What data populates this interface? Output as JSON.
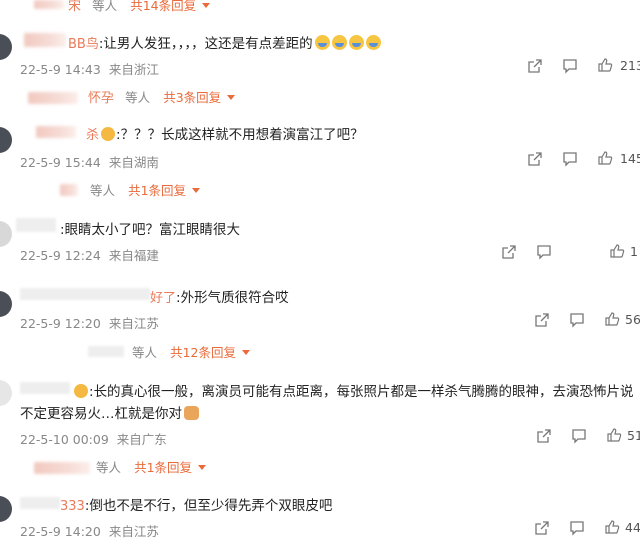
{
  "comments": [
    {
      "reply_thread": {
        "user": "宋",
        "dengren": "等人",
        "count_label": "共14条回复"
      },
      "user": "BB鸟",
      "text": "让男人发狂，，，，这还是有点差距的",
      "emoji_count": 4,
      "time": "22-5-9 14:43",
      "location": "来自浙江",
      "likes": "213"
    },
    {
      "reply_thread": {
        "user": "怀孕",
        "dengren": "等人",
        "count_label": "共3条回复"
      },
      "user": "杀",
      "text": "？？？长成这样就不用想着演富江了吧？",
      "time": "22-5-9 15:44",
      "location": "来自湖南",
      "likes": "145"
    },
    {
      "reply_thread": {
        "user": "",
        "dengren": "等人",
        "count_label": "共1条回复"
      },
      "user": "",
      "text": "眼睛太小了吧？富江眼睛很大",
      "time": "22-5-9 12:24",
      "location": "来自福建",
      "likes": "1"
    },
    {
      "user": "好了",
      "text": "外形气质很符合哎",
      "time": "22-5-9 12:20",
      "location": "来自江苏",
      "likes": "56"
    },
    {
      "reply_thread": {
        "user": "",
        "dengren": "等人",
        "count_label": "共12条回复"
      },
      "user": "",
      "text_line1": "长的真心很一般，离演员可能有点距离，每张照片都是一样杀气腾腾的眼神，去演恐怖片说",
      "text_line2": "不定更容易火…杠就是你对",
      "time": "22-5-10 00:09",
      "location": "来自广东",
      "likes": "51"
    },
    {
      "reply_thread": {
        "user": "",
        "dengren": "等人",
        "count_label": "共1条回复"
      },
      "user": "333",
      "text": "倒也不是不行，但至少得先弄个双眼皮吧",
      "time": "22-5-9 14:20",
      "location": "来自江苏",
      "likes": "44"
    }
  ]
}
